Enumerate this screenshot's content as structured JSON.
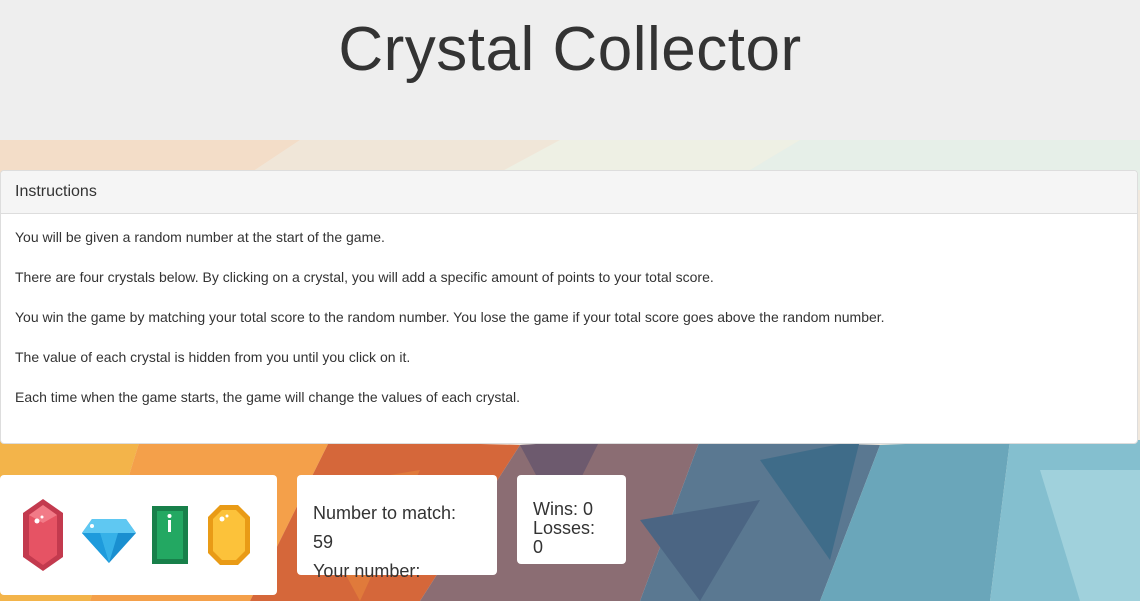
{
  "header": {
    "title": "Crystal Collector"
  },
  "instructions": {
    "heading": "Instructions",
    "paragraphs": [
      "You will be given a random number at the start of the game.",
      "There are four crystals below. By clicking on a crystal, you will add a specific amount of points to your total score.",
      "You win the game by matching your total score to the random number. You lose the game if your total score goes above the random number.",
      "The value of each crystal is hidden from you until you click on it.",
      "Each time when the game starts, the game will change the values of each crystal."
    ]
  },
  "crystals": [
    {
      "name": "red-crystal-icon",
      "color": "#d9495a"
    },
    {
      "name": "blue-diamond-icon",
      "color": "#1ea4e0"
    },
    {
      "name": "green-crystal-icon",
      "color": "#1f9a5a"
    },
    {
      "name": "yellow-crystal-icon",
      "color": "#f6b62a"
    }
  ],
  "game": {
    "number_to_match_label": "Number to match:",
    "number_to_match": "59",
    "your_number_label": "Your number:",
    "your_number": ""
  },
  "score": {
    "wins_label": "Wins:",
    "wins": "0",
    "losses_label": "Losses:",
    "losses": "0"
  }
}
